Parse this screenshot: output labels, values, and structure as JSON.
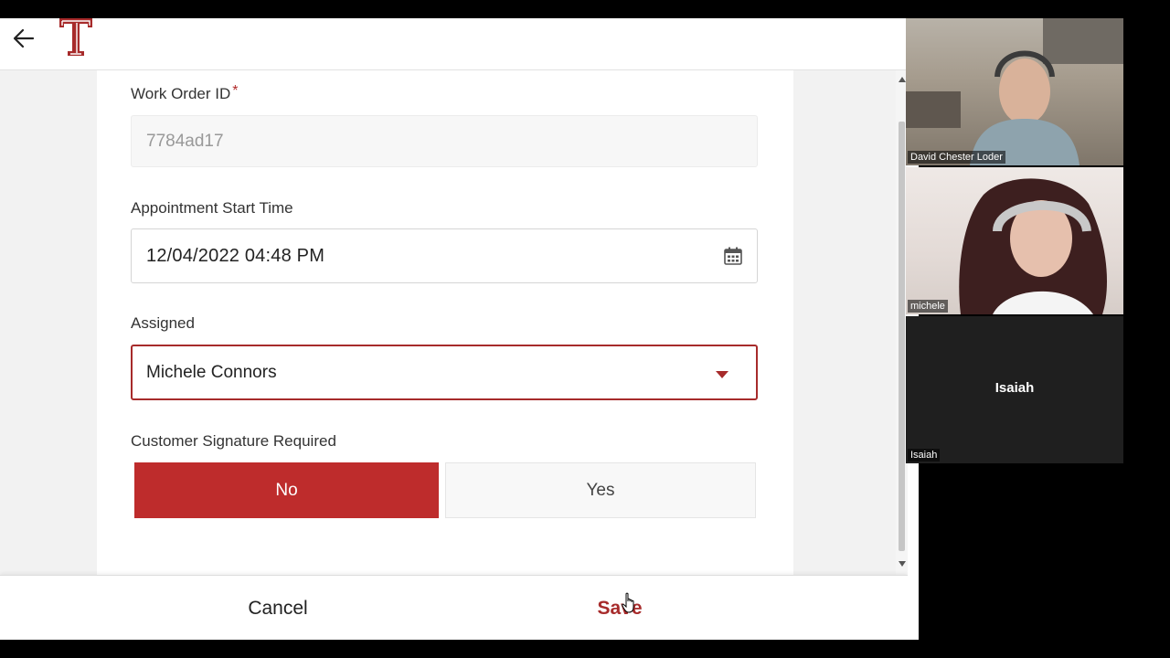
{
  "form": {
    "work_order_label": "Work Order ID",
    "required_mark": "*",
    "work_order_value": "7784ad17",
    "start_time_label": "Appointment Start Time",
    "start_time_value": "12/04/2022 04:48 PM",
    "assigned_label": "Assigned",
    "assigned_value": "Michele Connors",
    "signature_label": "Customer Signature Required",
    "signature_options": [
      "No",
      "Yes"
    ],
    "signature_selected": "No"
  },
  "footer": {
    "cancel_label": "Cancel",
    "save_label": "Save"
  },
  "icons": {
    "back": "arrow-left-icon",
    "logo": "temple-t-logo",
    "calendar": "calendar-icon",
    "dropdown": "caret-down-icon"
  },
  "colors": {
    "brand": "#a72b2b",
    "selected_button": "#be2c2c"
  },
  "video_call": {
    "participants": [
      {
        "name": "David Chester Loder"
      },
      {
        "name": "michele"
      },
      {
        "name": "Isaiah"
      }
    ],
    "no_video_display_name": "Isaiah"
  }
}
